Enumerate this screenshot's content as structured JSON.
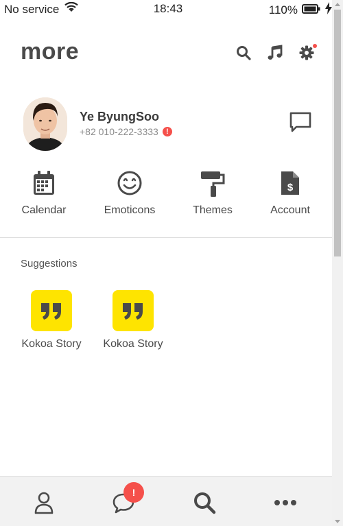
{
  "status_bar": {
    "carrier": "No service",
    "time": "18:43",
    "battery": "110%"
  },
  "header": {
    "title": "more",
    "icons": [
      "search-icon",
      "music-icon",
      "settings-icon"
    ]
  },
  "profile": {
    "name": "Ye ByungSoo",
    "phone": "+82 010-222-3333",
    "warning": "!"
  },
  "quick_menu": [
    {
      "label": "Calendar",
      "icon": "calendar-icon"
    },
    {
      "label": "Emoticons",
      "icon": "smile-icon"
    },
    {
      "label": "Themes",
      "icon": "paint-roller-icon"
    },
    {
      "label": "Account",
      "icon": "invoice-icon"
    }
  ],
  "suggestions": {
    "title": "Suggestions",
    "items": [
      {
        "label": "Kokoa Story",
        "icon": "quote-icon"
      },
      {
        "label": "Kokoa Story",
        "icon": "quote-icon"
      }
    ]
  },
  "tab_bar": {
    "tabs": [
      "friends-tab",
      "chats-tab",
      "search-tab",
      "more-tab"
    ],
    "chats_badge": "!"
  },
  "colors": {
    "accent_yellow": "#fee400",
    "badge_red": "#f5504b",
    "icon_gray": "#4a4a4a"
  }
}
